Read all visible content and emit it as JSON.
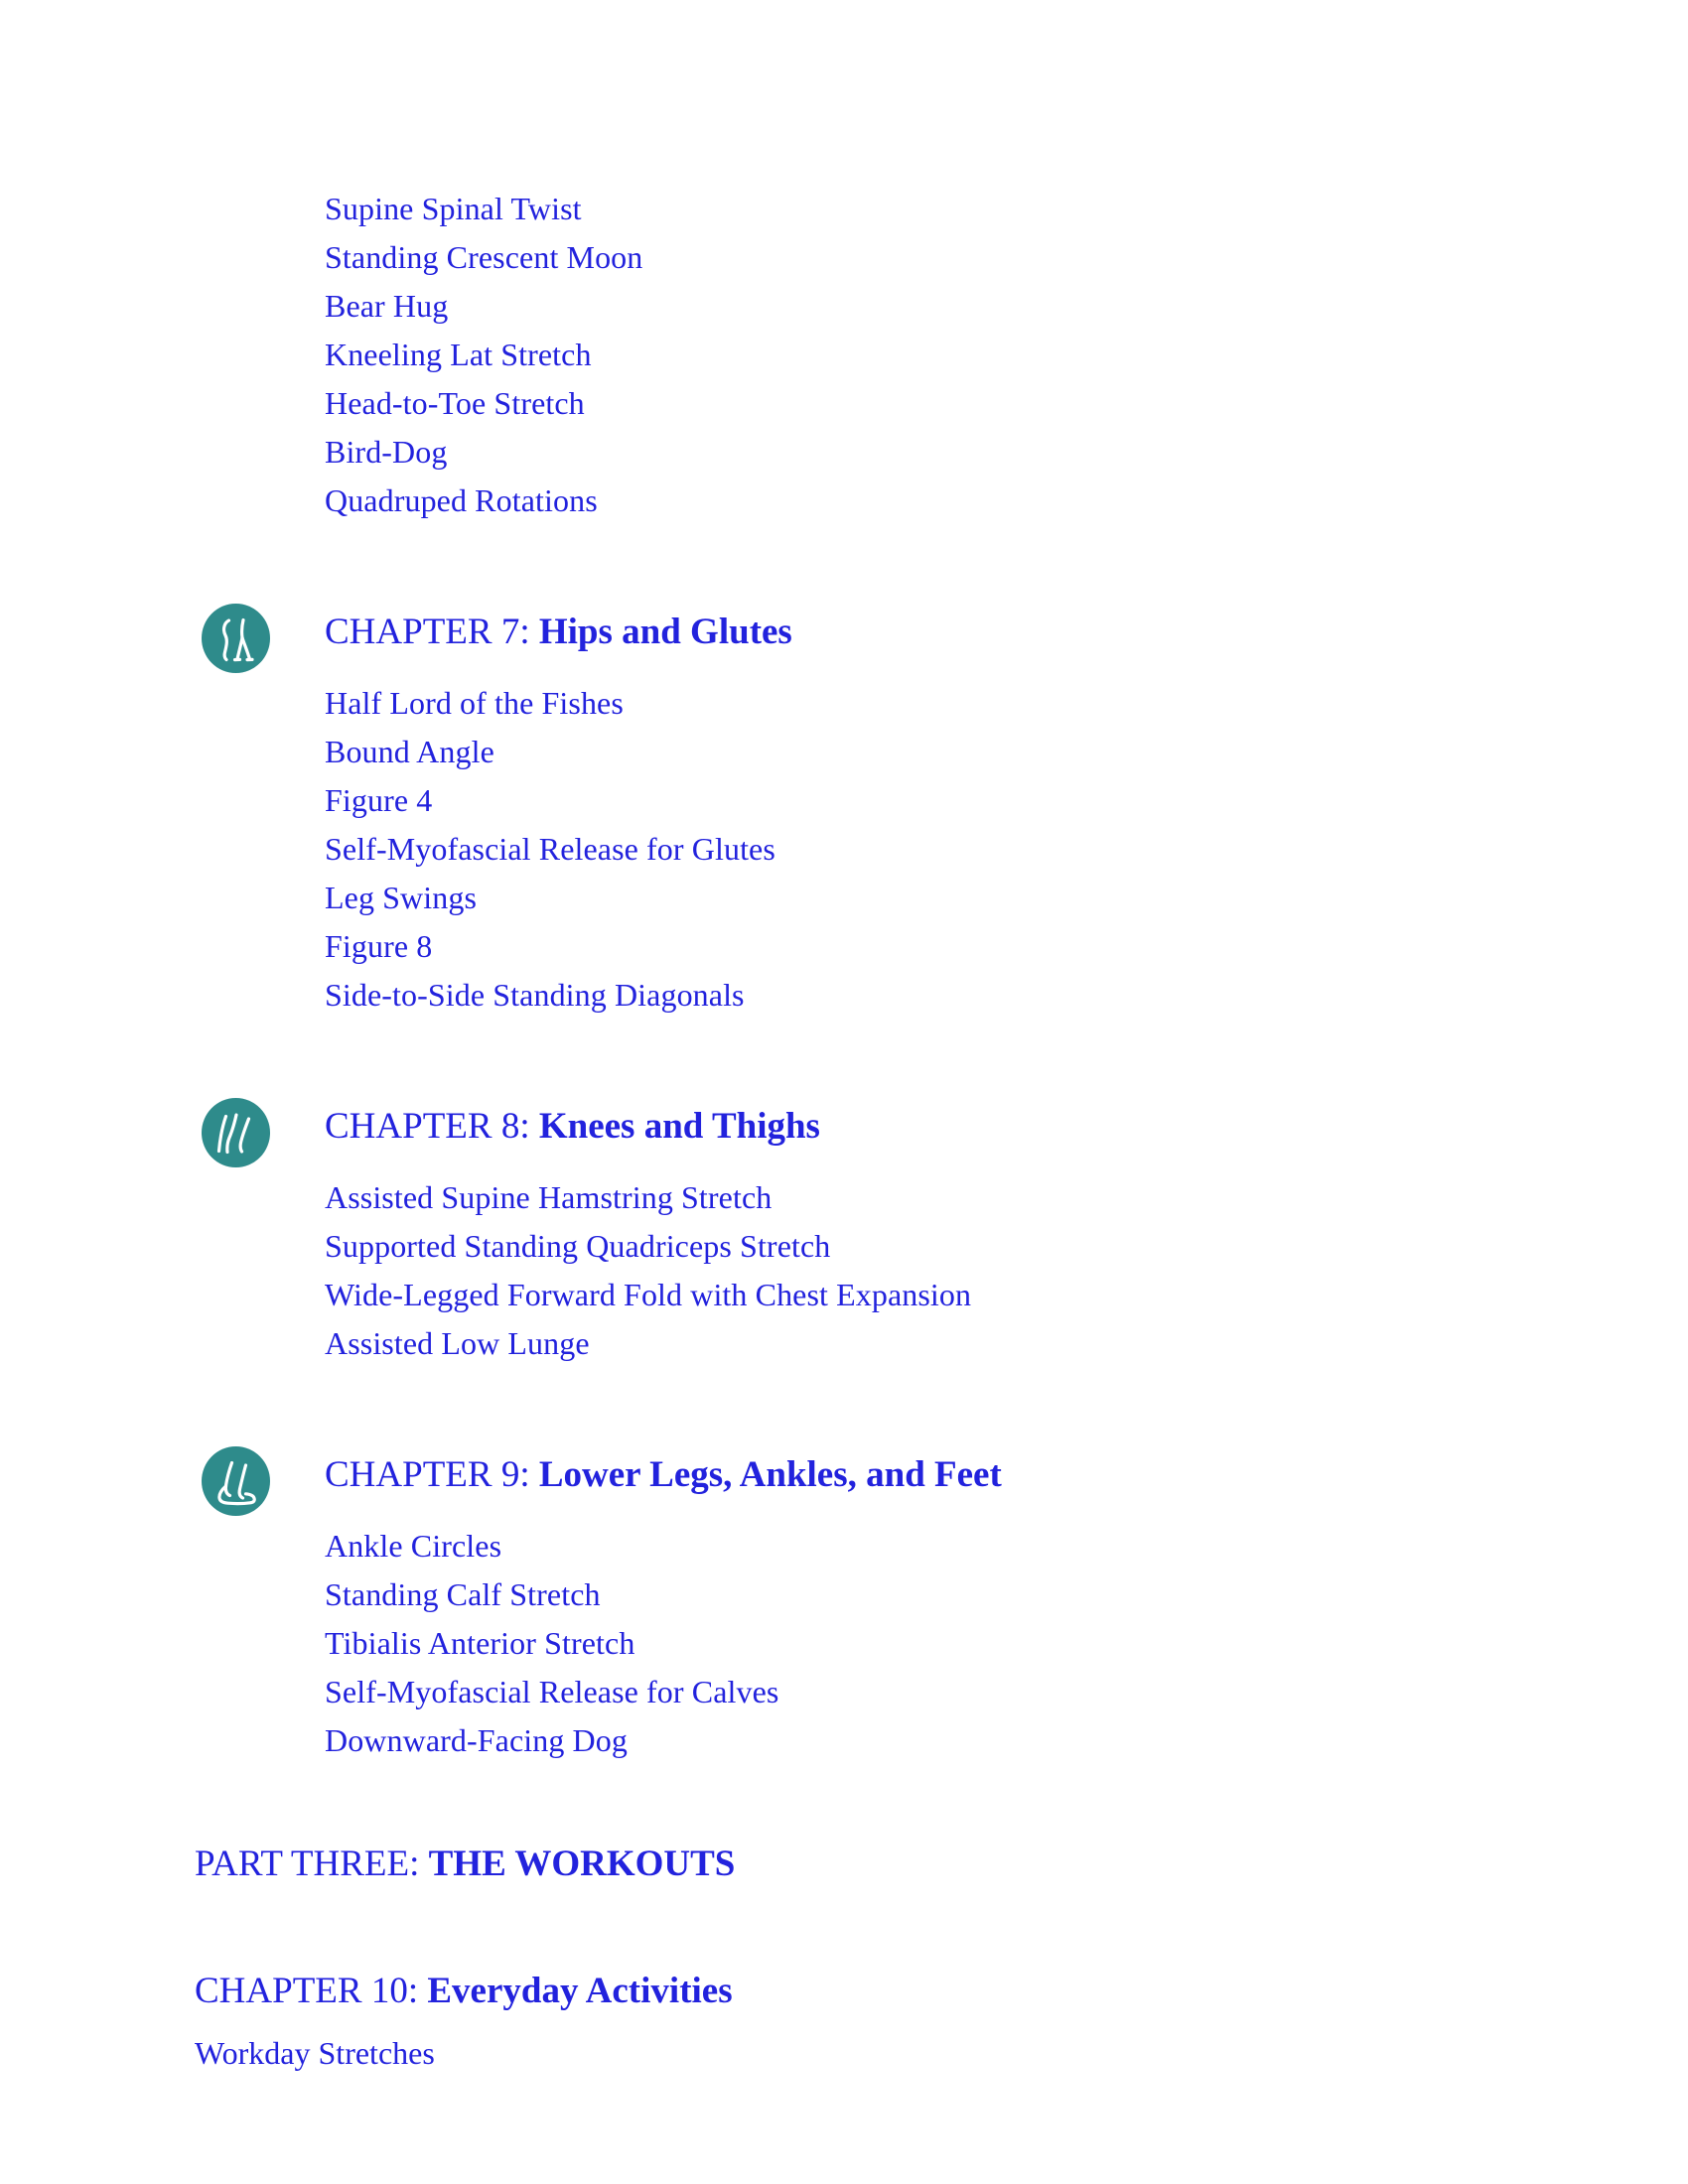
{
  "theme": {
    "text_color": "#2222dd",
    "icon_circle_color": "#2e8b8b",
    "icon_line_color": "#ffffff",
    "page_background": "#ffffff"
  },
  "continued_items": [
    "Supine Spinal Twist",
    "Standing Crescent Moon",
    "Bear Hug",
    "Kneeling Lat Stretch",
    "Head-to-Toe Stretch",
    "Bird-Dog",
    "Quadruped Rotations"
  ],
  "chapters": [
    {
      "number_label": "CHAPTER 7:",
      "title": "Hips and Glutes",
      "icon": "hips-and-glutes-icon",
      "items": [
        "Half Lord of the Fishes",
        "Bound Angle",
        "Figure 4",
        "Self-Myofascial Release for Glutes",
        "Leg Swings",
        "Figure 8",
        "Side-to-Side Standing Diagonals"
      ]
    },
    {
      "number_label": "CHAPTER 8:",
      "title": "Knees and Thighs",
      "icon": "knees-and-thighs-icon",
      "items": [
        "Assisted Supine Hamstring Stretch",
        "Supported Standing Quadriceps Stretch",
        "Wide-Legged Forward Fold with Chest Expansion",
        "Assisted Low Lunge"
      ]
    },
    {
      "number_label": "CHAPTER 9:",
      "title": "Lower Legs, Ankles, and Feet",
      "icon": "lower-legs-ankles-feet-icon",
      "items": [
        "Ankle Circles",
        "Standing Calf Stretch",
        "Tibialis Anterior Stretch",
        "Self-Myofascial Release for Calves",
        "Downward-Facing Dog"
      ]
    }
  ],
  "part_three": {
    "number_label": "PART THREE:",
    "title": "THE WORKOUTS"
  },
  "chapter_ten": {
    "number_label": "CHAPTER 10:",
    "title": "Everyday Activities",
    "items": [
      "Workday Stretches"
    ]
  }
}
